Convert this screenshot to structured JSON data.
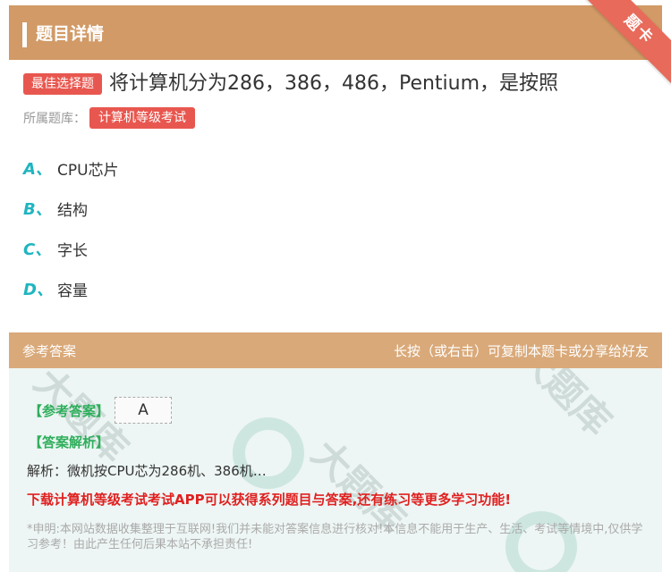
{
  "header": {
    "title": "题目详情",
    "ribbon": "题卡"
  },
  "question": {
    "type_badge": "最佳选择题",
    "text": "将计算机分为286，386，486，Pentium，是按照"
  },
  "bank": {
    "label": "所属题库：",
    "tag": "计算机等级考试"
  },
  "options": [
    {
      "letter": "A、",
      "text": "CPU芯片"
    },
    {
      "letter": "B、",
      "text": "结构"
    },
    {
      "letter": "C、",
      "text": "字长"
    },
    {
      "letter": "D、",
      "text": "容量"
    }
  ],
  "answer_section": {
    "title": "参考答案",
    "hint": "长按（或右击）可复制本题卡或分享给好友",
    "ref_label": "【参考答案】",
    "ref_value": "A",
    "analysis_label": "【答案解析】",
    "analysis_text": "解析：微机按CPU芯为286机、386机…",
    "promo": "下载计算机等级考试考试APP可以获得系列题目与答案,还有练习等更多学习功能!",
    "disclaimer": "*申明:本网站数据收集整理于互联网!我们并未能对答案信息进行核对!本信息不能用于生产、生活、考试等情境中,仅供学习参考！由此产生任何后果本站不承担责任!"
  },
  "colors": {
    "header_bg": "#d19a66",
    "badge_red": "#e8574f",
    "option_letter": "#1fb5c0",
    "answer_green": "#2eae5b"
  }
}
